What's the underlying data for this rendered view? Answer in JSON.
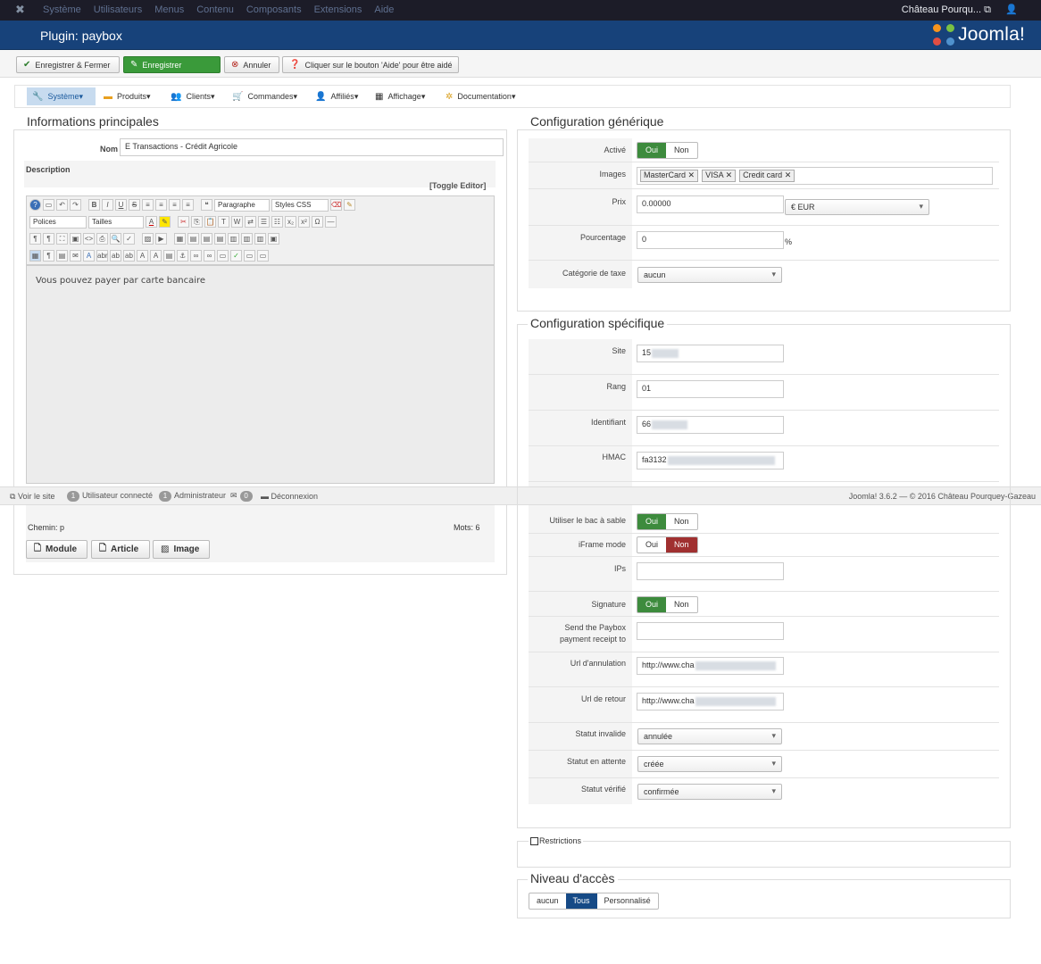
{
  "topnav": {
    "menu": [
      "Système",
      "Utilisateurs",
      "Menus",
      "Contenu",
      "Composants",
      "Extensions",
      "Aide"
    ],
    "site_name": "Château Pourqu...",
    "site_icon": "external-link-icon",
    "user_icon": "user-icon"
  },
  "title": "Plugin: paybox",
  "logo_text": "Joomla!",
  "toolbar": {
    "save_close": "Enregistrer & Fermer",
    "save": "Enregistrer",
    "cancel": "Annuler",
    "help": "Cliquer sur le bouton 'Aide' pour être aidé"
  },
  "submenu": [
    "Système",
    "Produits",
    "Clients",
    "Commandes",
    "Affiliés",
    "Affichage",
    "Documentation"
  ],
  "main_info": {
    "legend": "Informations principales",
    "name_label": "Nom",
    "name_value": "E Transactions - Crédit Agricole",
    "description_label": "Description",
    "toggle_editor": "[Toggle Editor]",
    "editor": {
      "format_select": "Paragraphe",
      "styles_select": "Styles CSS",
      "font_select": "Polices",
      "size_select": "Tailles",
      "content": "Vous pouvez payer par carte bancaire",
      "path": "Chemin: p",
      "words": "Mots: 6"
    },
    "buttons": [
      "Module",
      "Article",
      "Image"
    ]
  },
  "generic": {
    "legend": "Configuration générique",
    "active_label": "Activé",
    "yes": "Oui",
    "no": "Non",
    "images_label": "Images",
    "images_tags": [
      "MasterCard",
      "VISA",
      "Credit card"
    ],
    "price_label": "Prix",
    "price_value": "0.00000",
    "currency": "€ EUR",
    "percent_label": "Pourcentage",
    "percent_value": "0",
    "percent_unit": "%",
    "tax_label": "Catégorie de taxe",
    "tax_value": "aucun"
  },
  "specific": {
    "legend": "Configuration spécifique",
    "site_label": "Site",
    "site_value": "15",
    "rank_label": "Rang",
    "rank_value": "01",
    "id_label": "Identifiant",
    "id_value": "66",
    "hmac_label": "HMAC",
    "hmac_value": "fa3132",
    "sandbox_label": "Utiliser le bac à sable",
    "iframe_label": "iFrame mode",
    "ips_label": "IPs",
    "signature_label": "Signature",
    "receipt_label_1": "Send the Paybox",
    "receipt_label_2": "payment receipt to",
    "cancel_url_label": "Url d'annulation",
    "cancel_url_value": "http://www.cha",
    "return_url_label": "Url de retour",
    "return_url_value": "http://www.cha",
    "invalid_label": "Statut invalide",
    "invalid_value": "annulée",
    "pending_label": "Statut en attente",
    "pending_value": "créée",
    "verified_label": "Statut vérifié",
    "verified_value": "confirmée"
  },
  "restrictions": {
    "legend": "Restrictions"
  },
  "access": {
    "legend": "Niveau d'accès",
    "options": [
      "aucun",
      "Tous",
      "Personnalisé"
    ],
    "selected": "Tous"
  },
  "status_bar": {
    "view_site": "Voir le site",
    "connected_count": "1",
    "connected_label": "Utilisateur connecté",
    "admin_count": "1",
    "admin_label": "Administrateur",
    "messages_count": "0",
    "logout": "Déconnexion",
    "version": "Joomla! 3.6.2 — © 2016 Château Pourquey-Gazeau"
  },
  "colors": {
    "topnav_bg": "#1c1c28",
    "titlebar_bg": "#17427a",
    "green": "#3d8b3d",
    "red": "#a03030",
    "access_selected": "#164a86"
  }
}
